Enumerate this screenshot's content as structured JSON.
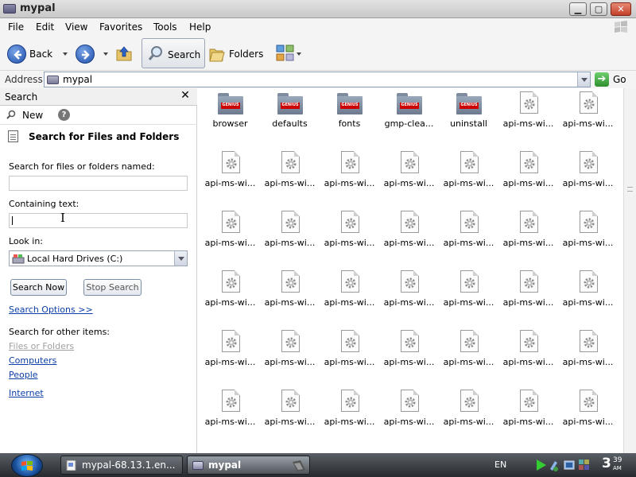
{
  "window": {
    "title": "mypal"
  },
  "menu": [
    "File",
    "Edit",
    "View",
    "Favorites",
    "Tools",
    "Help"
  ],
  "toolbar": {
    "back": "Back",
    "search": "Search",
    "folders": "Folders"
  },
  "address": {
    "label": "Address",
    "value": "mypal",
    "go": "Go"
  },
  "search_pane": {
    "title": "Search",
    "close": "✕",
    "new": "New",
    "heading": "Search for Files and Folders",
    "named_label": "Search for files or folders named:",
    "named_value": "",
    "containing_label": "Containing text:",
    "containing_value": "",
    "lookin_label": "Look in:",
    "lookin_value": "Local Hard Drives (C:)",
    "search_now": "Search Now",
    "stop_search": "Stop Search",
    "options_link": "Search Options >>",
    "other_label": "Search for other items:",
    "other_links": [
      "Files or Folders",
      "Computers",
      "People"
    ],
    "internet": "Internet"
  },
  "files": [
    {
      "name": "browser",
      "type": "folder"
    },
    {
      "name": "defaults",
      "type": "folder"
    },
    {
      "name": "fonts",
      "type": "folder"
    },
    {
      "name": "gmp-clea...",
      "type": "folder"
    },
    {
      "name": "uninstall",
      "type": "folder"
    },
    {
      "name": "api-ms-wi...",
      "type": "dll"
    },
    {
      "name": "api-ms-wi...",
      "type": "dll"
    },
    {
      "name": "api-ms-wi...",
      "type": "dll"
    },
    {
      "name": "api-ms-wi...",
      "type": "dll"
    },
    {
      "name": "api-ms-wi...",
      "type": "dll"
    },
    {
      "name": "api-ms-wi...",
      "type": "dll"
    },
    {
      "name": "api-ms-wi...",
      "type": "dll"
    },
    {
      "name": "api-ms-wi...",
      "type": "dll"
    },
    {
      "name": "api-ms-wi...",
      "type": "dll"
    },
    {
      "name": "api-ms-wi...",
      "type": "dll"
    },
    {
      "name": "api-ms-wi...",
      "type": "dll"
    },
    {
      "name": "api-ms-wi...",
      "type": "dll"
    },
    {
      "name": "api-ms-wi...",
      "type": "dll"
    },
    {
      "name": "api-ms-wi...",
      "type": "dll"
    },
    {
      "name": "api-ms-wi...",
      "type": "dll"
    },
    {
      "name": "api-ms-wi...",
      "type": "dll"
    },
    {
      "name": "api-ms-wi...",
      "type": "dll"
    },
    {
      "name": "api-ms-wi...",
      "type": "dll"
    },
    {
      "name": "api-ms-wi...",
      "type": "dll"
    },
    {
      "name": "api-ms-wi...",
      "type": "dll"
    },
    {
      "name": "api-ms-wi...",
      "type": "dll"
    },
    {
      "name": "api-ms-wi...",
      "type": "dll"
    },
    {
      "name": "api-ms-wi...",
      "type": "dll"
    },
    {
      "name": "api-ms-wi...",
      "type": "dll"
    },
    {
      "name": "api-ms-wi...",
      "type": "dll"
    },
    {
      "name": "api-ms-wi...",
      "type": "dll"
    },
    {
      "name": "api-ms-wi...",
      "type": "dll"
    },
    {
      "name": "api-ms-wi...",
      "type": "dll"
    },
    {
      "name": "api-ms-wi...",
      "type": "dll"
    },
    {
      "name": "api-ms-wi...",
      "type": "dll"
    },
    {
      "name": "api-ms-wi...",
      "type": "dll"
    },
    {
      "name": "api-ms-wi...",
      "type": "dll"
    },
    {
      "name": "api-ms-wi...",
      "type": "dll"
    },
    {
      "name": "api-ms-wi...",
      "type": "dll"
    },
    {
      "name": "api-ms-wi...",
      "type": "dll"
    },
    {
      "name": "api-ms-wi...",
      "type": "dll"
    },
    {
      "name": "api-ms-wi...",
      "type": "dll"
    }
  ],
  "folder_brand": "GENIUS",
  "taskbar": {
    "tasks": [
      "mypal-68.13.1.en...",
      "mypal"
    ],
    "lang": "EN",
    "clock_hour": "3",
    "clock_min": "39",
    "clock_ampm": "AM"
  },
  "icons": {
    "back": "back-arrow-icon",
    "forward": "forward-arrow-icon",
    "up": "folder-up-icon",
    "search": "magnifier-icon",
    "folders": "folders-icon",
    "views": "views-icon",
    "go": "go-arrow-icon",
    "drive": "drive-icon",
    "help": "help-icon",
    "gear": "gear-icon",
    "folder": "folder-icon"
  },
  "colors": {
    "link": "#0b3ea8",
    "disabled_link": "#a0a0a0",
    "taskbar": "#26292d",
    "folder_brand": "#cc0000"
  }
}
